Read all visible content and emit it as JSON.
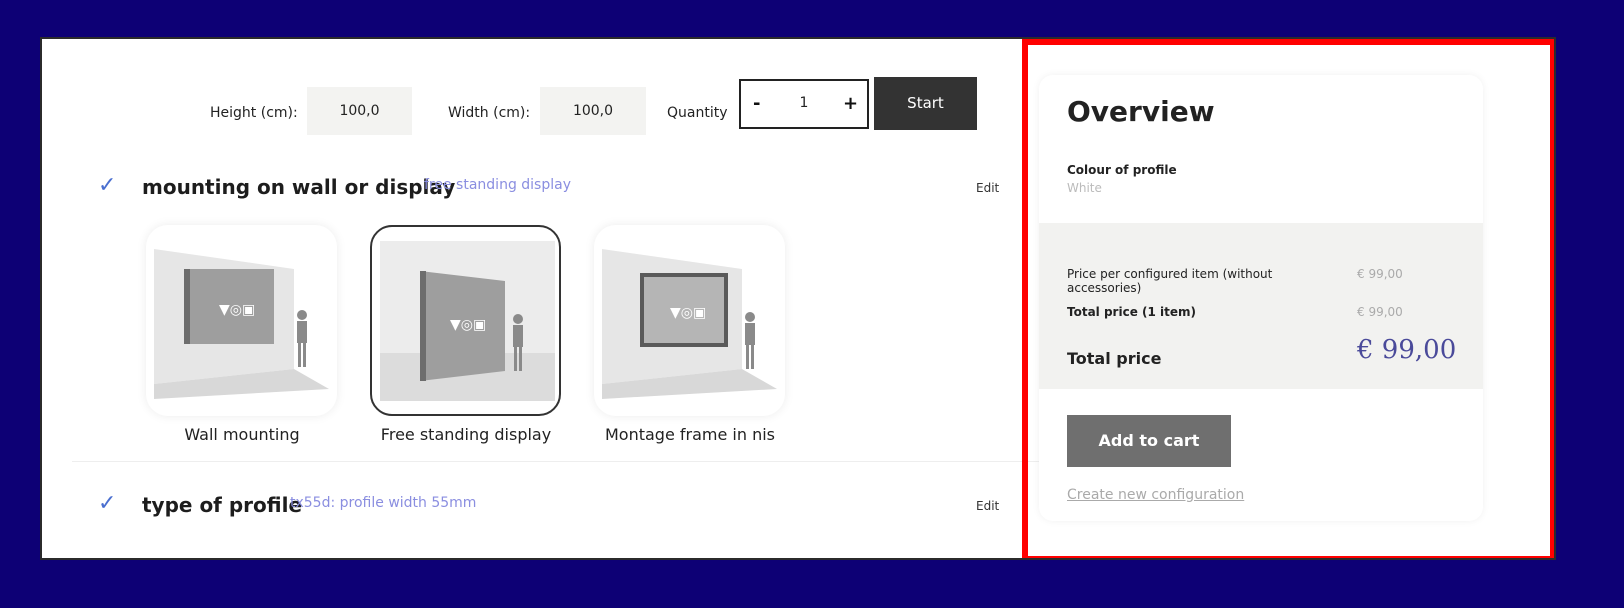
{
  "dimensions": {
    "height_label": "Height (cm):",
    "height_value": "100,0",
    "width_label": "Width (cm):",
    "width_value": "100,0",
    "quantity_label": "Quantity",
    "quantity_minus": "-",
    "quantity_value": "1",
    "quantity_plus": "+",
    "start_label": "Start"
  },
  "sections": [
    {
      "check": "✓",
      "title": "mounting on wall or display",
      "value": "free standing display",
      "edit_label": "Edit",
      "options": [
        {
          "label": "Wall mounting",
          "selected": false
        },
        {
          "label": "Free standing display",
          "selected": true
        },
        {
          "label": "Montage frame in nis",
          "selected": false
        }
      ]
    },
    {
      "check": "✓",
      "title": "type of profile",
      "value": "tx55d: profile width 55mm",
      "edit_label": "Edit"
    }
  ],
  "overview": {
    "title": "Overview",
    "colour_label": "Colour of profile",
    "colour_value": "White",
    "price_item_label": "Price per configured item (without accessories)",
    "price_item_value": "€ 99,00",
    "total_items_label": "Total price (1 item)",
    "total_items_value": "€ 99,00",
    "total_label": "Total price",
    "total_value": "€ 99,00",
    "add_to_cart_label": "Add to cart",
    "new_config_label": "Create new configuration"
  },
  "colors": {
    "background": "#0d0075",
    "highlight": "#ff0000",
    "check": "#4a6fd0",
    "section_value": "#8a8ee0"
  }
}
